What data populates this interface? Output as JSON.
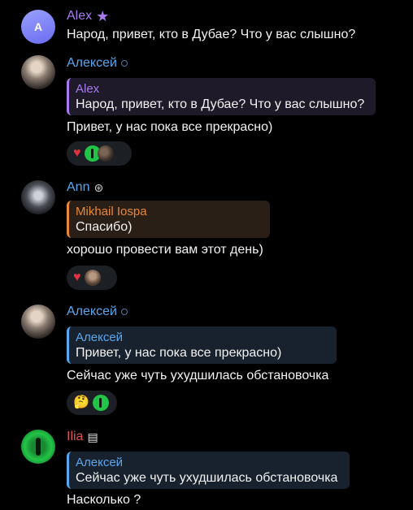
{
  "messages": [
    {
      "sender": "Alex",
      "sender_color": "#a87cf0",
      "avatar_letter": "A",
      "badge": "star-icon",
      "text": "Народ, привет, кто в Дубае? Что у вас слышно?"
    },
    {
      "sender": "Алексей",
      "sender_color": "#5aa7f0",
      "badge": "circle-icon",
      "reply": {
        "name": "Alex",
        "text": "Народ, привет, кто в Дубае? Что у вас слышно?",
        "color": "#a87cf0"
      },
      "text": "Привет, у нас пока все прекрасно)",
      "reactions": [
        "heart-icon",
        "green-avatar",
        "photo-avatar"
      ]
    },
    {
      "sender": "Ann",
      "sender_color": "#5aa7f0",
      "badge": "saturn-icon",
      "reply": {
        "name": "Mikhail Iospa",
        "text": "Спасибо)",
        "color": "#e8883a"
      },
      "text": "хорошо провести вам этот день)",
      "reactions": [
        "heart-icon",
        "photo-avatar"
      ]
    },
    {
      "sender": "Алексей",
      "sender_color": "#5aa7f0",
      "badge": "circle-icon",
      "reply": {
        "name": "Алексей",
        "text": "Привет, у нас пока все прекрасно)",
        "color": "#5aa7f0"
      },
      "text": "Сейчас уже чуть ухудшилась обстановочка",
      "reactions": [
        "thinking-icon",
        "green-avatar"
      ]
    },
    {
      "sender": "Ilia",
      "sender_color": "#e0544f",
      "badge": "document-icon",
      "reply": {
        "name": "Алексей",
        "text": "Сейчас уже чуть ухудшилась обстановочка",
        "color": "#5aa7f0"
      },
      "text": "Насколько ?"
    }
  ],
  "symbols": {
    "heart": "♥",
    "star": "★",
    "thinking": "🤔",
    "saturn": "🪐",
    "doc": "▤"
  }
}
